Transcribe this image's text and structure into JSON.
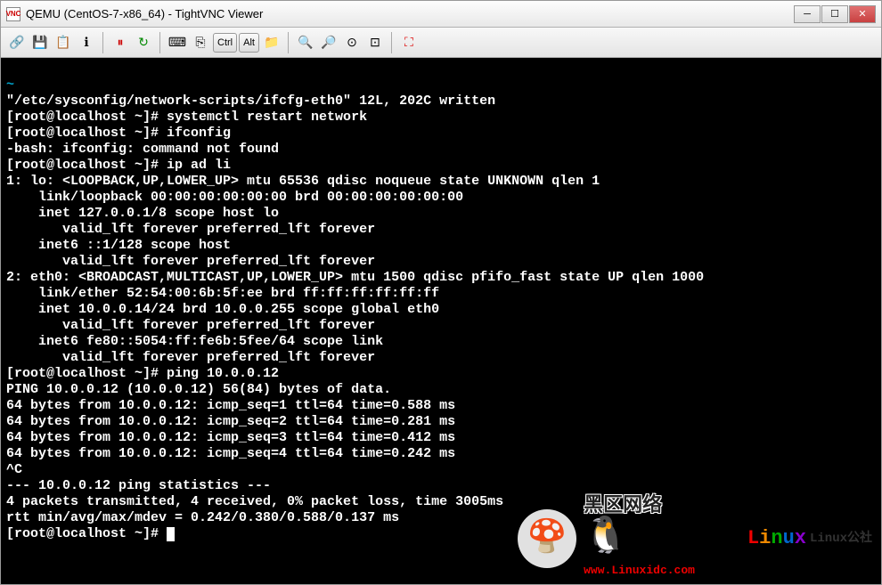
{
  "window": {
    "title": "QEMU (CentOS-7-x86_64) - TightVNC Viewer",
    "icon_label": "VNC"
  },
  "toolbar": {
    "btn_new": "new-connection-icon",
    "btn_save": "save-icon",
    "btn_options": "options-icon",
    "btn_info": "info-icon",
    "btn_pause": "pause-icon",
    "btn_refresh": "refresh-icon",
    "btn_cad": "ctrl-alt-del-icon",
    "btn_ctrlesc": "send-keys-icon",
    "ctrl_label": "Ctrl",
    "alt_label": "Alt",
    "btn_transfer": "file-transfer-icon",
    "btn_zoomin": "zoom-in-icon",
    "btn_zoomout": "zoom-out-icon",
    "btn_zoom100": "zoom-100-icon",
    "btn_zoomauto": "zoom-auto-icon",
    "btn_fullscreen": "fullscreen-icon"
  },
  "terminal": {
    "lines": [
      "~",
      "\"/etc/sysconfig/network-scripts/ifcfg-eth0\" 12L, 202C written",
      "[root@localhost ~]# systemctl restart network",
      "[root@localhost ~]# ifconfig",
      "-bash: ifconfig: command not found",
      "[root@localhost ~]# ip ad li",
      "1: lo: <LOOPBACK,UP,LOWER_UP> mtu 65536 qdisc noqueue state UNKNOWN qlen 1",
      "    link/loopback 00:00:00:00:00:00 brd 00:00:00:00:00:00",
      "    inet 127.0.0.1/8 scope host lo",
      "       valid_lft forever preferred_lft forever",
      "    inet6 ::1/128 scope host",
      "       valid_lft forever preferred_lft forever",
      "2: eth0: <BROADCAST,MULTICAST,UP,LOWER_UP> mtu 1500 qdisc pfifo_fast state UP qlen 1000",
      "    link/ether 52:54:00:6b:5f:ee brd ff:ff:ff:ff:ff:ff",
      "    inet 10.0.0.14/24 brd 10.0.0.255 scope global eth0",
      "       valid_lft forever preferred_lft forever",
      "    inet6 fe80::5054:ff:fe6b:5fee/64 scope link",
      "       valid_lft forever preferred_lft forever",
      "[root@localhost ~]# ping 10.0.0.12",
      "PING 10.0.0.12 (10.0.0.12) 56(84) bytes of data.",
      "64 bytes from 10.0.0.12: icmp_seq=1 ttl=64 time=0.588 ms",
      "64 bytes from 10.0.0.12: icmp_seq=2 ttl=64 time=0.281 ms",
      "64 bytes from 10.0.0.12: icmp_seq=3 ttl=64 time=0.412 ms",
      "64 bytes from 10.0.0.12: icmp_seq=4 ttl=64 time=0.242 ms",
      "^C",
      "--- 10.0.0.12 ping statistics ---",
      "4 packets transmitted, 4 received, 0% packet loss, time 3005ms",
      "rtt min/avg/max/mdev = 0.242/0.380/0.588/0.137 ms",
      "[root@localhost ~]# "
    ]
  },
  "watermark": {
    "cn": "黑区网络",
    "brand_letters": [
      "L",
      "i",
      "n",
      "u",
      "x"
    ],
    "url": "www.Linuxidc.com",
    "subtitle": "Linux公社"
  }
}
